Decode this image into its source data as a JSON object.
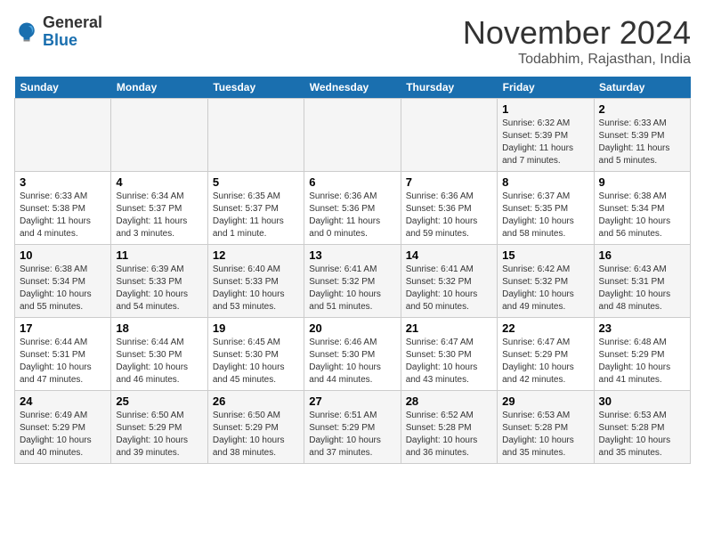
{
  "logo": {
    "general": "General",
    "blue": "Blue"
  },
  "header": {
    "month": "November 2024",
    "location": "Todabhim, Rajasthan, India"
  },
  "weekdays": [
    "Sunday",
    "Monday",
    "Tuesday",
    "Wednesday",
    "Thursday",
    "Friday",
    "Saturday"
  ],
  "weeks": [
    [
      {
        "day": "",
        "sunrise": "",
        "sunset": "",
        "daylight": ""
      },
      {
        "day": "",
        "sunrise": "",
        "sunset": "",
        "daylight": ""
      },
      {
        "day": "",
        "sunrise": "",
        "sunset": "",
        "daylight": ""
      },
      {
        "day": "",
        "sunrise": "",
        "sunset": "",
        "daylight": ""
      },
      {
        "day": "",
        "sunrise": "",
        "sunset": "",
        "daylight": ""
      },
      {
        "day": "1",
        "sunrise": "Sunrise: 6:32 AM",
        "sunset": "Sunset: 5:39 PM",
        "daylight": "Daylight: 11 hours and 7 minutes."
      },
      {
        "day": "2",
        "sunrise": "Sunrise: 6:33 AM",
        "sunset": "Sunset: 5:39 PM",
        "daylight": "Daylight: 11 hours and 5 minutes."
      }
    ],
    [
      {
        "day": "3",
        "sunrise": "Sunrise: 6:33 AM",
        "sunset": "Sunset: 5:38 PM",
        "daylight": "Daylight: 11 hours and 4 minutes."
      },
      {
        "day": "4",
        "sunrise": "Sunrise: 6:34 AM",
        "sunset": "Sunset: 5:37 PM",
        "daylight": "Daylight: 11 hours and 3 minutes."
      },
      {
        "day": "5",
        "sunrise": "Sunrise: 6:35 AM",
        "sunset": "Sunset: 5:37 PM",
        "daylight": "Daylight: 11 hours and 1 minute."
      },
      {
        "day": "6",
        "sunrise": "Sunrise: 6:36 AM",
        "sunset": "Sunset: 5:36 PM",
        "daylight": "Daylight: 11 hours and 0 minutes."
      },
      {
        "day": "7",
        "sunrise": "Sunrise: 6:36 AM",
        "sunset": "Sunset: 5:36 PM",
        "daylight": "Daylight: 10 hours and 59 minutes."
      },
      {
        "day": "8",
        "sunrise": "Sunrise: 6:37 AM",
        "sunset": "Sunset: 5:35 PM",
        "daylight": "Daylight: 10 hours and 58 minutes."
      },
      {
        "day": "9",
        "sunrise": "Sunrise: 6:38 AM",
        "sunset": "Sunset: 5:34 PM",
        "daylight": "Daylight: 10 hours and 56 minutes."
      }
    ],
    [
      {
        "day": "10",
        "sunrise": "Sunrise: 6:38 AM",
        "sunset": "Sunset: 5:34 PM",
        "daylight": "Daylight: 10 hours and 55 minutes."
      },
      {
        "day": "11",
        "sunrise": "Sunrise: 6:39 AM",
        "sunset": "Sunset: 5:33 PM",
        "daylight": "Daylight: 10 hours and 54 minutes."
      },
      {
        "day": "12",
        "sunrise": "Sunrise: 6:40 AM",
        "sunset": "Sunset: 5:33 PM",
        "daylight": "Daylight: 10 hours and 53 minutes."
      },
      {
        "day": "13",
        "sunrise": "Sunrise: 6:41 AM",
        "sunset": "Sunset: 5:32 PM",
        "daylight": "Daylight: 10 hours and 51 minutes."
      },
      {
        "day": "14",
        "sunrise": "Sunrise: 6:41 AM",
        "sunset": "Sunset: 5:32 PM",
        "daylight": "Daylight: 10 hours and 50 minutes."
      },
      {
        "day": "15",
        "sunrise": "Sunrise: 6:42 AM",
        "sunset": "Sunset: 5:32 PM",
        "daylight": "Daylight: 10 hours and 49 minutes."
      },
      {
        "day": "16",
        "sunrise": "Sunrise: 6:43 AM",
        "sunset": "Sunset: 5:31 PM",
        "daylight": "Daylight: 10 hours and 48 minutes."
      }
    ],
    [
      {
        "day": "17",
        "sunrise": "Sunrise: 6:44 AM",
        "sunset": "Sunset: 5:31 PM",
        "daylight": "Daylight: 10 hours and 47 minutes."
      },
      {
        "day": "18",
        "sunrise": "Sunrise: 6:44 AM",
        "sunset": "Sunset: 5:30 PM",
        "daylight": "Daylight: 10 hours and 46 minutes."
      },
      {
        "day": "19",
        "sunrise": "Sunrise: 6:45 AM",
        "sunset": "Sunset: 5:30 PM",
        "daylight": "Daylight: 10 hours and 45 minutes."
      },
      {
        "day": "20",
        "sunrise": "Sunrise: 6:46 AM",
        "sunset": "Sunset: 5:30 PM",
        "daylight": "Daylight: 10 hours and 44 minutes."
      },
      {
        "day": "21",
        "sunrise": "Sunrise: 6:47 AM",
        "sunset": "Sunset: 5:30 PM",
        "daylight": "Daylight: 10 hours and 43 minutes."
      },
      {
        "day": "22",
        "sunrise": "Sunrise: 6:47 AM",
        "sunset": "Sunset: 5:29 PM",
        "daylight": "Daylight: 10 hours and 42 minutes."
      },
      {
        "day": "23",
        "sunrise": "Sunrise: 6:48 AM",
        "sunset": "Sunset: 5:29 PM",
        "daylight": "Daylight: 10 hours and 41 minutes."
      }
    ],
    [
      {
        "day": "24",
        "sunrise": "Sunrise: 6:49 AM",
        "sunset": "Sunset: 5:29 PM",
        "daylight": "Daylight: 10 hours and 40 minutes."
      },
      {
        "day": "25",
        "sunrise": "Sunrise: 6:50 AM",
        "sunset": "Sunset: 5:29 PM",
        "daylight": "Daylight: 10 hours and 39 minutes."
      },
      {
        "day": "26",
        "sunrise": "Sunrise: 6:50 AM",
        "sunset": "Sunset: 5:29 PM",
        "daylight": "Daylight: 10 hours and 38 minutes."
      },
      {
        "day": "27",
        "sunrise": "Sunrise: 6:51 AM",
        "sunset": "Sunset: 5:29 PM",
        "daylight": "Daylight: 10 hours and 37 minutes."
      },
      {
        "day": "28",
        "sunrise": "Sunrise: 6:52 AM",
        "sunset": "Sunset: 5:28 PM",
        "daylight": "Daylight: 10 hours and 36 minutes."
      },
      {
        "day": "29",
        "sunrise": "Sunrise: 6:53 AM",
        "sunset": "Sunset: 5:28 PM",
        "daylight": "Daylight: 10 hours and 35 minutes."
      },
      {
        "day": "30",
        "sunrise": "Sunrise: 6:53 AM",
        "sunset": "Sunset: 5:28 PM",
        "daylight": "Daylight: 10 hours and 35 minutes."
      }
    ]
  ]
}
